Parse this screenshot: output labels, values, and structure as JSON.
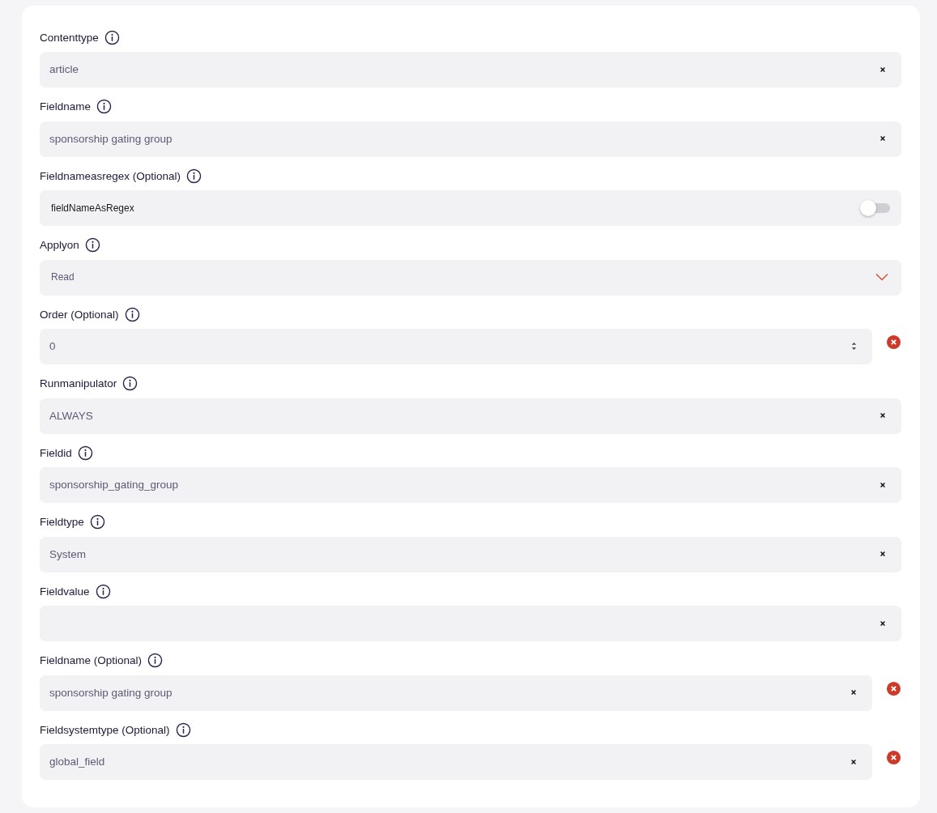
{
  "fields": [
    {
      "kind": "text",
      "label": "Contenttype",
      "value": "article",
      "removable": false
    },
    {
      "kind": "text",
      "label": "Fieldname",
      "value": "sponsorship gating group",
      "removable": false
    },
    {
      "kind": "toggle",
      "label": "Fieldnameasregex (Optional)",
      "value": "fieldNameAsRegex",
      "on": false,
      "removable": false
    },
    {
      "kind": "select",
      "label": "Applyon",
      "value": "Read",
      "removable": false
    },
    {
      "kind": "number",
      "label": "Order (Optional)",
      "value": "0",
      "removable": true
    },
    {
      "kind": "text",
      "label": "Runmanipulator",
      "value": "ALWAYS",
      "removable": false
    },
    {
      "kind": "text",
      "label": "Fieldid",
      "value": "sponsorship_gating_group",
      "removable": false
    },
    {
      "kind": "text",
      "label": "Fieldtype",
      "value": "System",
      "removable": false
    },
    {
      "kind": "text",
      "label": "Fieldvalue",
      "removable": false
    },
    {
      "kind": "text",
      "label": "Fieldname (Optional)",
      "value": "sponsorship gating group",
      "removable": true
    },
    {
      "kind": "text",
      "label": "Fieldsystemtype (Optional)",
      "value": "global_field",
      "removable": true
    }
  ]
}
